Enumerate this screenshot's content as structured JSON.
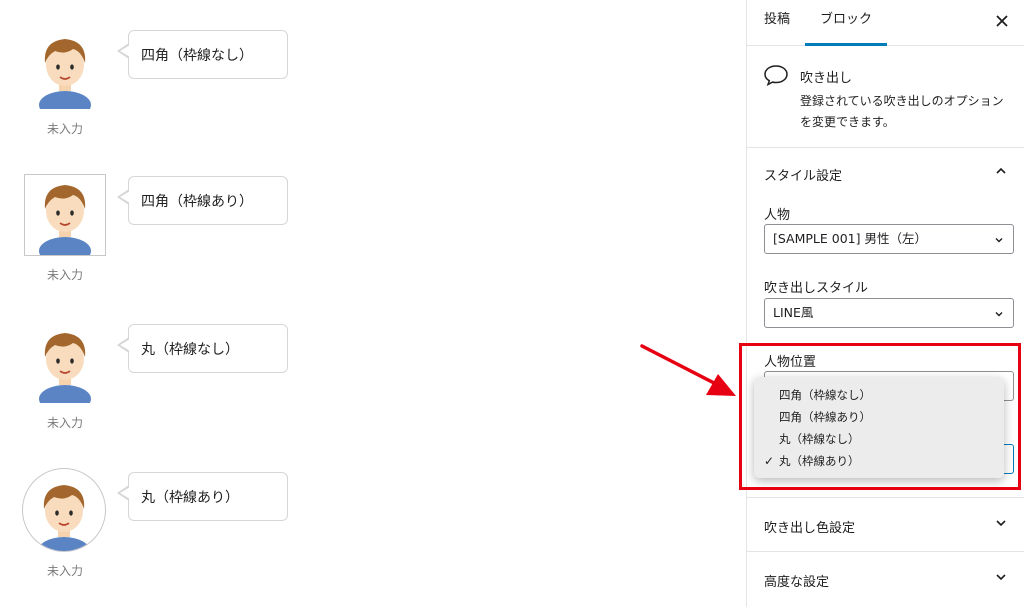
{
  "canvas": {
    "blocks": [
      {
        "avatar_name": "未入力",
        "bubble_text": "四角（枠線なし）"
      },
      {
        "avatar_name": "未入力",
        "bubble_text": "四角（枠線あり）"
      },
      {
        "avatar_name": "未入力",
        "bubble_text": "丸（枠線なし）"
      },
      {
        "avatar_name": "未入力",
        "bubble_text": "丸（枠線あり）"
      }
    ]
  },
  "sidebar": {
    "tabs": {
      "post": "投稿",
      "block": "ブロック"
    },
    "close_icon": "close-icon",
    "block_card": {
      "icon": "speech-bubble-icon",
      "title": "吹き出し",
      "description": "登録されている吹き出しのオプションを変更できます。"
    },
    "style_panel": {
      "title": "スタイル設定",
      "person_label": "人物",
      "person_value": "[SAMPLE 001] 男性（左）",
      "balloon_style_label": "吹き出しスタイル",
      "balloon_style_value": "LINE風",
      "position_label": "人物位置"
    },
    "dropdown": {
      "options": [
        "四角（枠線なし）",
        "四角（枠線あり）",
        "丸（枠線なし）",
        "丸（枠線あり）"
      ],
      "selected_index": 3,
      "check_mark": "✓"
    },
    "color_panel": {
      "title": "吹き出し色設定"
    },
    "advanced_panel": {
      "title": "高度な設定"
    }
  },
  "colors": {
    "accent": "#007cba",
    "highlight": "#e60012",
    "arrow": "#e60012"
  }
}
